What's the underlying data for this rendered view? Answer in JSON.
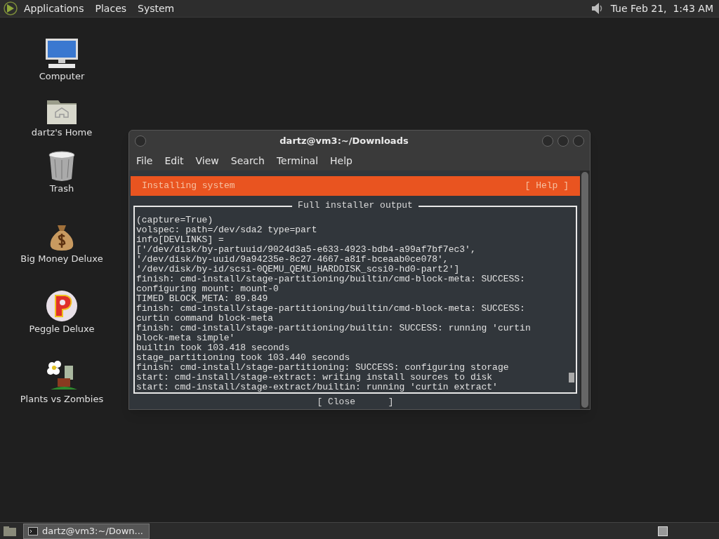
{
  "top_panel": {
    "menus": [
      "Applications",
      "Places",
      "System"
    ],
    "clock": "Tue Feb 21,  1:43 AM"
  },
  "desktop_icons": [
    {
      "label": "Computer",
      "kind": "computer"
    },
    {
      "label": "dartz's Home",
      "kind": "home"
    },
    {
      "label": "Trash",
      "kind": "trash"
    },
    {
      "label": "Big Money Deluxe",
      "kind": "moneybag"
    },
    {
      "label": "Peggle Deluxe",
      "kind": "peggle"
    },
    {
      "label": "Plants vs Zombies",
      "kind": "plants"
    }
  ],
  "window": {
    "title": "dartz@vm3:~/Downloads",
    "menu": [
      "File",
      "Edit",
      "View",
      "Search",
      "Terminal",
      "Help"
    ],
    "header": {
      "title": "Installing system",
      "help": "[ Help ]"
    },
    "output_title": "Full installer output",
    "output_lines": [
      "(capture=True)",
      "volspec: path=/dev/sda2 type=part",
      "info[DEVLINKS] =",
      "['/dev/disk/by-partuuid/9024d3a5-e633-4923-bdb4-a99af7bf7ec3',",
      "'/dev/disk/by-uuid/9a94235e-8c27-4667-a81f-bceaab0ce078',",
      "'/dev/disk/by-id/scsi-0QEMU_QEMU_HARDDISK_scsi0-hd0-part2']",
      "finish: cmd-install/stage-partitioning/builtin/cmd-block-meta: SUCCESS:",
      "configuring mount: mount-0",
      "TIMED BLOCK_META: 89.849",
      "finish: cmd-install/stage-partitioning/builtin/cmd-block-meta: SUCCESS:",
      "curtin command block-meta",
      "finish: cmd-install/stage-partitioning/builtin: SUCCESS: running 'curtin",
      "block-meta simple'",
      "builtin took 103.418 seconds",
      "stage_partitioning took 103.440 seconds",
      "finish: cmd-install/stage-partitioning: SUCCESS: configuring storage",
      "start: cmd-install/stage-extract: writing install sources to disk",
      "start: cmd-install/stage-extract/builtin: running 'curtin extract'"
    ],
    "close_button": "[ Close      ]"
  },
  "taskbar": {
    "tasks": [
      {
        "label": "dartz@vm3:~/Down...",
        "selected": true
      }
    ]
  }
}
